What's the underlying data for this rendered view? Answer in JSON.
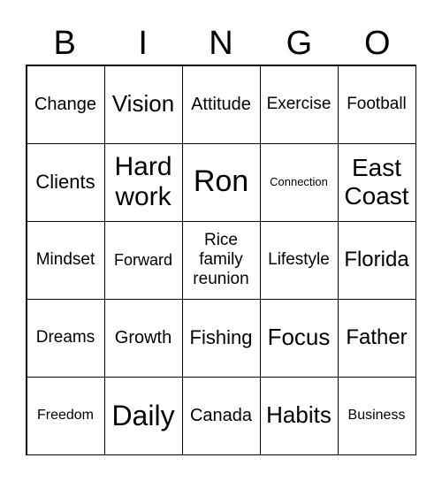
{
  "header": [
    "B",
    "I",
    "N",
    "G",
    "O"
  ],
  "cells": [
    "Change",
    "Vision",
    "Attitude",
    "Exercise",
    "Football",
    "Clients",
    "Hard work",
    "Ron",
    "Connection",
    "East Coast",
    "Mindset",
    "Forward",
    "Rice family reunion",
    "Lifestyle",
    "Florida",
    "Dreams",
    "Growth",
    "Fishing",
    "Focus",
    "Father",
    "Freedom",
    "Daily",
    "Canada",
    "Habits",
    "Business"
  ]
}
